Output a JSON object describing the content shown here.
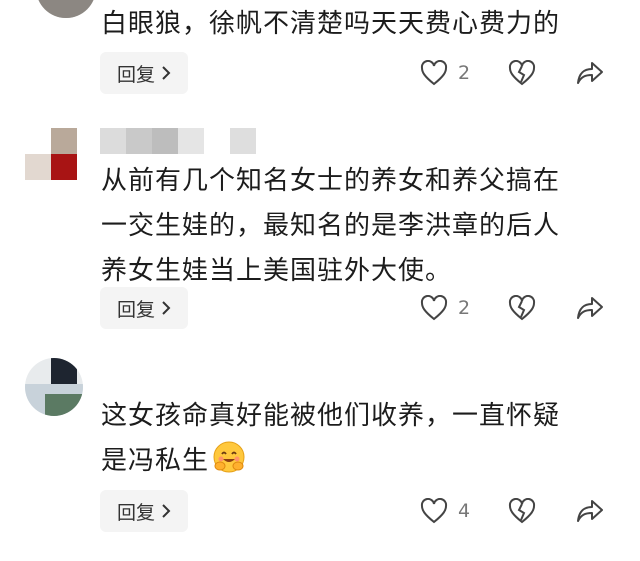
{
  "comments": [
    {
      "text_lines": [
        "白眼狼，徐帆不清楚吗天天费心费力的"
      ],
      "reply_label": "回复",
      "like_count": "2"
    },
    {
      "text_lines": [
        "从前有几个知名女士的养女和养父搞在",
        "一交生娃的，最知名的是李洪章的后人",
        "养女生娃当上美国驻外大使。"
      ],
      "reply_label": "回复",
      "like_count": "2"
    },
    {
      "text_lines": [
        "这女孩命真好能被他们收养，一直怀疑",
        "是冯私生"
      ],
      "reply_label": "回复",
      "like_count": "4",
      "emoji": "hugging-face-icon"
    }
  ],
  "icons": {
    "like": "heart-outline-icon",
    "dislike": "broken-heart-icon",
    "share": "share-arrow-icon",
    "reply_chevron": "chevron-right-icon"
  },
  "colors": {
    "text": "#1c1c1c",
    "button_bg": "#f4f4f4",
    "icon": "#444444",
    "count": "#777777"
  }
}
